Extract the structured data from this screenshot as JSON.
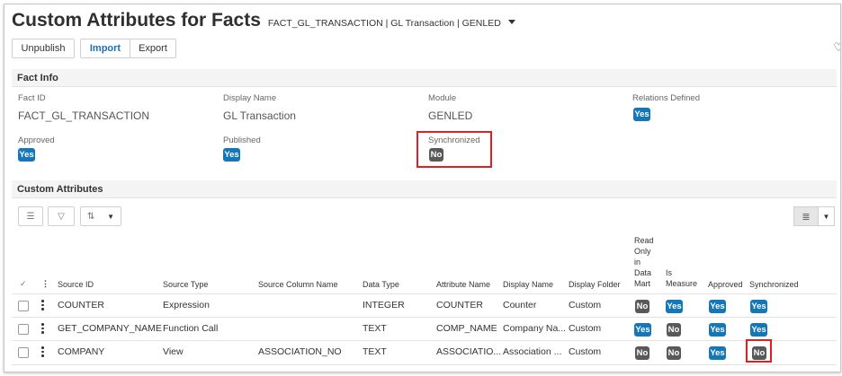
{
  "header": {
    "title": "Custom Attributes for Facts",
    "subtitle": "FACT_GL_TRANSACTION | GL Transaction | GENLED",
    "heart_icon": "heart-icon"
  },
  "toolbar": {
    "unpublish": "Unpublish",
    "import": "Import",
    "export": "Export"
  },
  "fact_info": {
    "heading": "Fact Info",
    "fact_id_label": "Fact ID",
    "fact_id": "FACT_GL_TRANSACTION",
    "display_name_label": "Display Name",
    "display_name": "GL Transaction",
    "module_label": "Module",
    "module": "GENLED",
    "relations_label": "Relations Defined",
    "relations": "Yes",
    "approved_label": "Approved",
    "approved": "Yes",
    "published_label": "Published",
    "published": "Yes",
    "synchronized_label": "Synchronized",
    "synchronized": "No"
  },
  "custom_attributes": {
    "heading": "Custom Attributes",
    "columns": {
      "check": "✓",
      "menu": "⋮",
      "source_id": "Source ID",
      "source_type": "Source Type",
      "source_column": "Source Column Name",
      "data_type": "Data Type",
      "attribute_name": "Attribute Name",
      "display_name": "Display Name",
      "display_folder": "Display Folder",
      "read_only": [
        "Read",
        "Only",
        "in",
        "Data",
        "Mart"
      ],
      "is_measure": [
        "Is",
        "Measure"
      ],
      "approved": "Approved",
      "synchronized": "Synchronized"
    },
    "rows": [
      {
        "source_id": "COUNTER",
        "source_type": "Expression",
        "source_column": "",
        "data_type": "INTEGER",
        "attribute_name": "COUNTER",
        "display_name": "Counter",
        "display_folder": "Custom",
        "read_only": "No",
        "is_measure": "Yes",
        "approved": "Yes",
        "synchronized": "Yes"
      },
      {
        "source_id": "GET_COMPANY_NAME",
        "source_type": "Function Call",
        "source_column": "",
        "data_type": "TEXT",
        "attribute_name": "COMP_NAME",
        "display_name": "Company Na...",
        "display_folder": "Custom",
        "read_only": "Yes",
        "is_measure": "No",
        "approved": "Yes",
        "synchronized": "Yes"
      },
      {
        "source_id": "COMPANY",
        "source_type": "View",
        "source_column": "ASSOCIATION_NO",
        "data_type": "TEXT",
        "attribute_name": "ASSOCIATIO...",
        "display_name": "Association ...",
        "display_folder": "Custom",
        "read_only": "No",
        "is_measure": "No",
        "approved": "Yes",
        "synchronized": "No"
      }
    ]
  },
  "colors": {
    "yes": "#1477b8",
    "no": "#595959",
    "highlight": "#e02020"
  }
}
